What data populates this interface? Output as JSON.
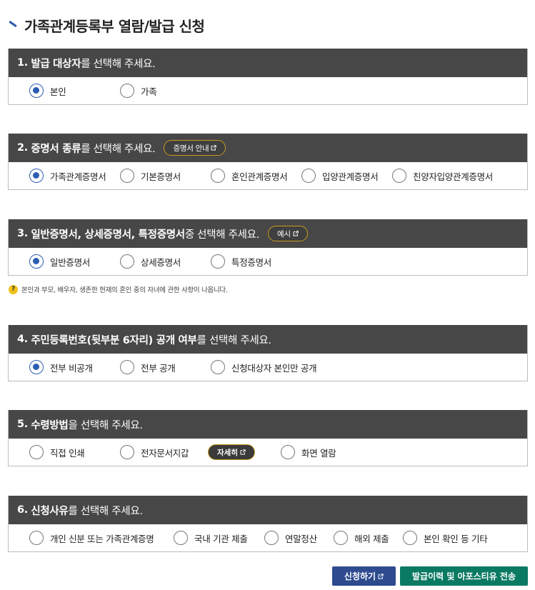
{
  "page": {
    "title": "가족관계등록부 열람/발급 신청"
  },
  "sections": [
    {
      "num": "1.",
      "head_bold": "발급 대상자",
      "head_rest": "를 선택해 주세요.",
      "options": [
        {
          "label": "본인",
          "selected": true
        },
        {
          "label": "가족",
          "selected": false
        }
      ]
    },
    {
      "num": "2.",
      "head_bold": "증명서 종류",
      "head_rest": "를 선택해 주세요.",
      "pill": "증명서 안내",
      "options": [
        {
          "label": "가족관계증명서",
          "selected": true
        },
        {
          "label": "기본증명서",
          "selected": false
        },
        {
          "label": "혼인관계증명서",
          "selected": false
        },
        {
          "label": "입양관계증명서",
          "selected": false
        },
        {
          "label": "친양자입양관계증명서",
          "selected": false
        }
      ]
    },
    {
      "num": "3.",
      "head_bold": "일반증명서, 상세증명서, 특정증명서",
      "head_rest": " 중 선택해 주세요.",
      "pill": "예시",
      "options": [
        {
          "label": "일반증명서",
          "selected": true
        },
        {
          "label": "상세증명서",
          "selected": false
        },
        {
          "label": "특정증명서",
          "selected": false
        }
      ],
      "note": "본인과 부모, 배우자, 생존한 현재의 혼인 중의 자녀에 관한 사항이 나옵니다."
    },
    {
      "num": "4.",
      "head_bold": "주민등록번호(뒷부분 6자리) 공개 여부",
      "head_rest": "를 선택해 주세요.",
      "options": [
        {
          "label": "전부 비공개",
          "selected": true
        },
        {
          "label": "전부 공개",
          "selected": false
        },
        {
          "label": "신청대상자 본인만 공개",
          "selected": false
        }
      ]
    },
    {
      "num": "5.",
      "head_bold": "수령방법",
      "head_rest": "을 선택해 주세요.",
      "options": [
        {
          "label": "직접 인쇄",
          "selected": false
        },
        {
          "label": "전자문서지갑",
          "selected": false
        },
        {
          "label": "화면 열람",
          "selected": false
        }
      ],
      "detail_pill": "자세히"
    },
    {
      "num": "6.",
      "head_bold": "신청사유",
      "head_rest": "를 선택해 주세요.",
      "options": [
        {
          "label": "개인 신분 또는 가족관계증명",
          "selected": false
        },
        {
          "label": "국내 기관 제출",
          "selected": false
        },
        {
          "label": "연말정산",
          "selected": false
        },
        {
          "label": "해외 제출",
          "selected": false
        },
        {
          "label": "본인 확인 등 기타",
          "selected": false
        }
      ]
    }
  ],
  "buttons": {
    "apply": "신청하기",
    "send": "발급이력 및 아포스티유 전송"
  },
  "colors": {
    "header_bg": "#474747",
    "radio_selected": "#2b5eb3",
    "pill_border": "#c99a1d",
    "apply_button": "#2e4b8f",
    "send_button": "#0b7a63"
  },
  "icons": {
    "external_link": "external-link-icon",
    "help": "question-icon"
  }
}
